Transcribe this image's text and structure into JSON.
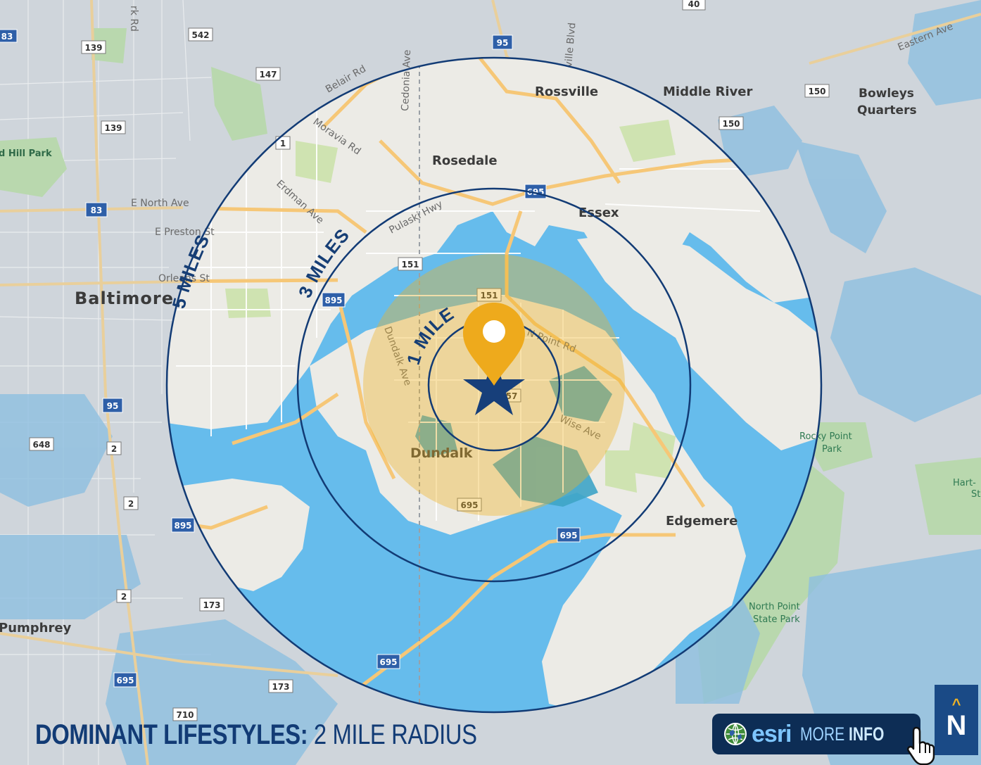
{
  "footer": {
    "title_strong": "DOMINANT LIFESTYLES:",
    "title_light": "2 MILE RADIUS"
  },
  "more_info": {
    "logo": "esri",
    "label_light": "MORE",
    "label_bold": "INFO"
  },
  "north_arrow": {
    "letter": "N"
  },
  "rings": {
    "five": "5 MILES",
    "three": "3 MILES",
    "one": "1 MILE"
  },
  "places": {
    "baltimore": "Baltimore",
    "rossville": "Rossville",
    "middle_river": "Middle River",
    "bowleys_1": "Bowleys",
    "bowleys_2": "Quarters",
    "rosedale": "Rosedale",
    "essex": "Essex",
    "dundalk": "Dundalk",
    "edgemere": "Edgemere",
    "pumphrey": "Pumphrey",
    "hill_park": "d Hill Park"
  },
  "parks": {
    "rocky_point_1": "Rocky Point",
    "rocky_point_2": "Park",
    "north_point_1": "North Point",
    "north_point_2": "State Park",
    "hart_1": "Hart-",
    "hart_2": "St"
  },
  "roads": {
    "belair": "Belair Rd",
    "cedonia": "Cedonia Ave",
    "moravia": "Moravia Rd",
    "erdman": "Erdman Ave",
    "pulaski": "Pulaski Hwy",
    "e_north": "E North Ave",
    "e_preston": "E Preston St",
    "orleans": "Orleans St",
    "dundalk_ave": "Dundalk Ave",
    "n_point_rd": "N Point Rd",
    "wise_ave": "Wise Ave",
    "eastern_ave": "Eastern Ave",
    "rk_rd": "rk Rd",
    "ville_blvd": "ville Blvd"
  },
  "shields": {
    "s83a": "83",
    "s542": "542",
    "s139a": "139",
    "s147": "147",
    "s139b": "139",
    "s1": "1",
    "s83b": "83",
    "s95a": "95",
    "s40": "40",
    "s150a": "150",
    "s150b": "150",
    "s695a": "695",
    "s151a": "151",
    "s151b": "151",
    "s895": "895",
    "s57": "57",
    "s95b": "95",
    "s648": "648",
    "s2a": "2",
    "s2b": "2",
    "s895b": "895",
    "s695b": "695",
    "s695c": "695",
    "s2c": "2",
    "s173a": "173",
    "s695d": "695",
    "s695e": "695",
    "s173b": "173",
    "s710": "710"
  },
  "colors": {
    "water": "#66bcec",
    "land_outside": "#cfd5db",
    "land_inside": "#ecebe6",
    "ring_stroke": "#123b75",
    "one_mile_fill": "#f0b323",
    "pin": "#eeaa1c",
    "star": "#173f7a",
    "highway": "#f6c777"
  }
}
